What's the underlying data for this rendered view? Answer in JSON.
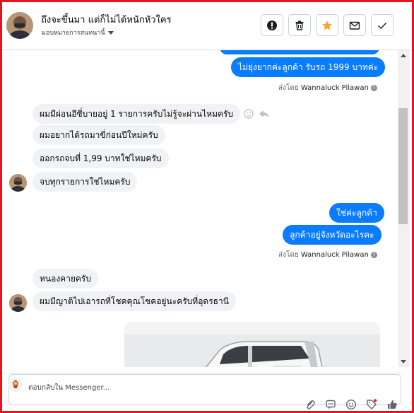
{
  "header": {
    "title": "ถึงจะขึ้นมา แต่ก็ไม่ได้หนักหัวใคร",
    "subtitle": "มอบหมายการสนทนานี้",
    "actions": [
      "alert-icon",
      "trash-icon",
      "star-icon",
      "mail-icon",
      "check-icon"
    ],
    "star_color": "#f5a623"
  },
  "messages": [
    {
      "side": "out",
      "text": "ไม่ยุ่งยากค่ะลูกค้า รับรถ 1999 บาทค่ะ"
    },
    {
      "side": "sent_by",
      "prefix": "ส่งโดย",
      "name": "Wannaluck Pilawan"
    },
    {
      "side": "in",
      "text": "ผมมีผ่อนอีซี่บายอยู่ 1 รายการครับไม่รู้จะผ่านไหมครับ"
    },
    {
      "side": "in",
      "text": "ผมอยากได้รถมาขี่ก่อนปีใหม่ครับ"
    },
    {
      "side": "in",
      "text": "ออกรถจบที่ 1,99 บาทใช่ไหมครับ"
    },
    {
      "side": "in",
      "text": "จบทุกรายการใช่ไหมครับ"
    },
    {
      "side": "out",
      "text": "ใช่ค่ะลูกค้า"
    },
    {
      "side": "out",
      "text": "ลูกค้าอยู่จังหวัดอะไรคะ"
    },
    {
      "side": "sent_by",
      "prefix": "ส่งโดย",
      "name": "Wannaluck Pilawan"
    },
    {
      "side": "in",
      "text": "หนองคายครับ"
    },
    {
      "side": "in",
      "text": "ผมมีญาติไปเอารถที่โชคคุณโชคอยู่นะครับที่อุดรธานี"
    }
  ],
  "composer": {
    "placeholder": "ตอบกลับใน Messenger...",
    "tools": [
      "paperclip-icon",
      "quick-reply-icon",
      "emoji-icon",
      "tag-icon",
      "like-icon"
    ]
  },
  "colors": {
    "brand": "#0a7cff",
    "frame": "#e8141c",
    "incoming": "#f0f2f5"
  }
}
